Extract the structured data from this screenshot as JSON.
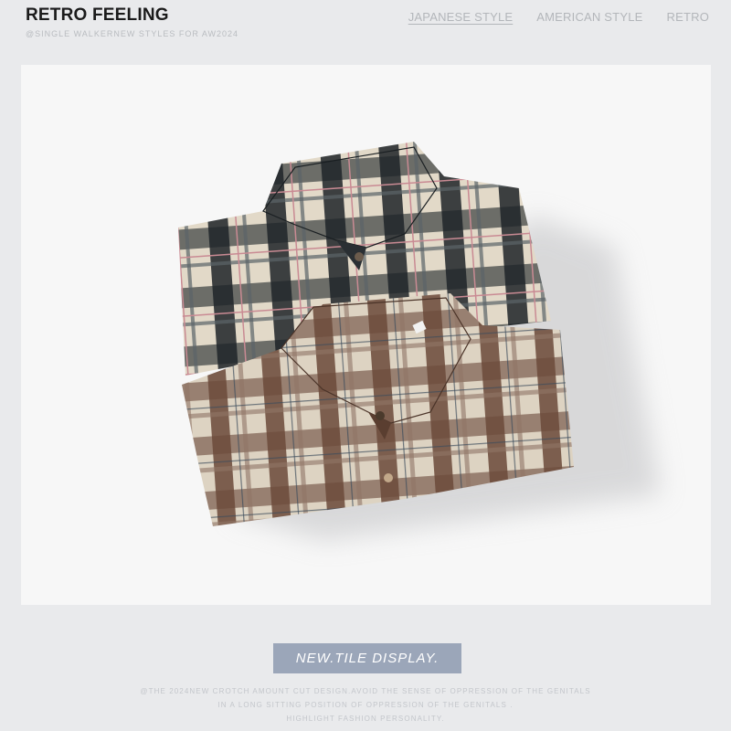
{
  "brand": {
    "title": "RETRO FEELING",
    "subtitle": "@SINGLE WALKERNEW STYLES FOR AW2024"
  },
  "nav": {
    "items": [
      {
        "label": "JAPANESE STYLE",
        "active": true
      },
      {
        "label": "AMERICAN STYLE",
        "active": false
      },
      {
        "label": "RETRO",
        "active": false
      }
    ]
  },
  "hero": {
    "image_subject": "two folded plaid flannel shirts, black/beige and brown/beige",
    "colors": {
      "background": "#f7f7f7",
      "dark_shirt_base": "#e2d9c8",
      "dark_shirt_check": "#1e2428",
      "dark_shirt_stripe": "#c98a93",
      "brown_shirt_base": "#ddd3c2",
      "brown_shirt_check": "#6b4a3a"
    }
  },
  "cta": {
    "label": "NEW.TILE DISPLAY."
  },
  "description": {
    "lines": [
      "@THE 2024NEW CROTCH AMOUNT CUT DESIGN.AVOID THE SENSE OF OPPRESSION OF THE GENITALS",
      "IN A LONG SITTING POSITION OF OPPRESSION OF THE GENITALS .",
      "HIGHLIGHT FASHION PERSONALITY."
    ]
  }
}
